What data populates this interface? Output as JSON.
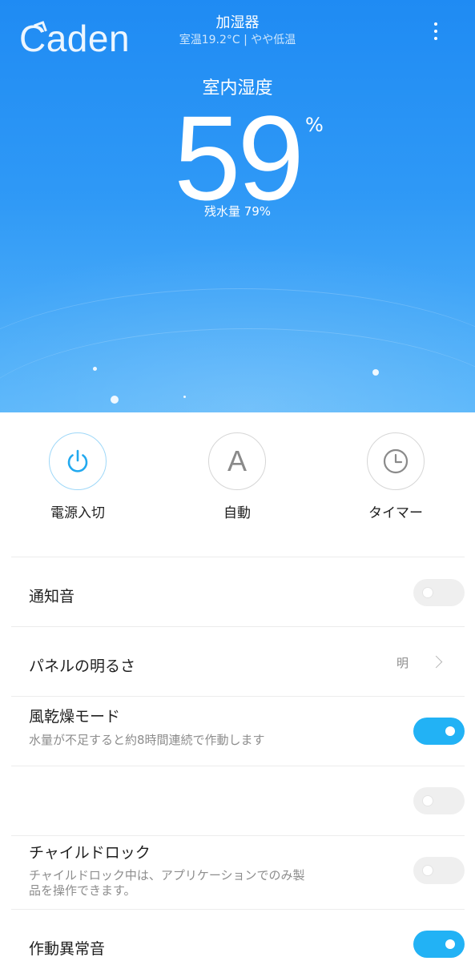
{
  "header": {
    "logo_text": "Caden",
    "title": "加湿器",
    "subtitle": "室温19.2°C | やや低温"
  },
  "status": {
    "humidity_label": "室内湿度",
    "humidity_value": "59",
    "humidity_unit": "%",
    "water_remaining": "残水量 79%"
  },
  "controls": [
    {
      "label": "電源入切",
      "icon": "power-icon",
      "active": true
    },
    {
      "label": "自動",
      "icon": "auto-icon",
      "letter": "A",
      "active": false
    },
    {
      "label": "タイマー",
      "icon": "clock-icon",
      "active": false
    }
  ],
  "settings": {
    "notification_sound": {
      "title": "通知音",
      "on": false
    },
    "panel_brightness": {
      "title": "パネルの明るさ",
      "value": "明"
    },
    "dry_mode": {
      "title": "風乾燥モード",
      "desc": "水量が不足すると約8時間連続で作動します",
      "on": true
    },
    "unlabeled_toggle": {
      "on": false
    },
    "child_lock": {
      "title": "チャイルドロック",
      "desc_line1": "チャイルドロック中は、アプリケーションでのみ製",
      "desc_line2": "品を操作できます。",
      "on": false
    },
    "error_sound": {
      "title": "作動異常音",
      "on": true
    }
  },
  "colors": {
    "hero_top": "#1f8bf3",
    "hero_bottom": "#59b6fa",
    "toggle_on": "#22b2f5",
    "power_icon": "#22a9ef"
  }
}
